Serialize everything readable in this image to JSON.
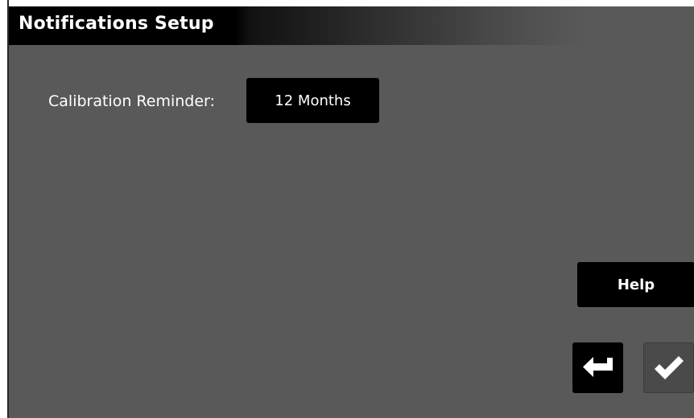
{
  "window": {
    "title": "Notifications Setup"
  },
  "settings": {
    "calibration_reminder": {
      "label": "Calibration Reminder:",
      "value": "12 Months"
    }
  },
  "buttons": {
    "help_label": "Help",
    "back_icon": "return-arrow-icon",
    "accept_icon": "checkmark-icon"
  },
  "colors": {
    "background": "#595959",
    "button": "#000000",
    "text": "#ffffff",
    "accept_button_disabled": "#4a4a4a"
  }
}
